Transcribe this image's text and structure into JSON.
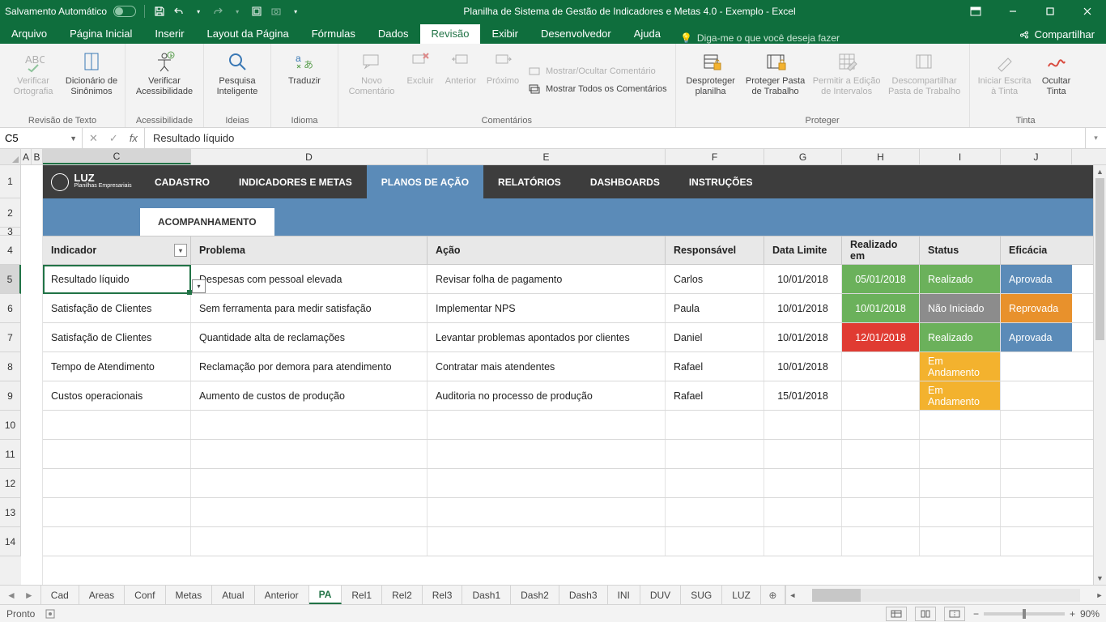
{
  "titlebar": {
    "autosave_label": "Salvamento Automático",
    "title": "Planilha de Sistema de Gestão de Indicadores e Metas 4.0 - Exemplo  -  Excel"
  },
  "menutabs": {
    "file": "Arquivo",
    "home": "Página Inicial",
    "insert": "Inserir",
    "layout": "Layout da Página",
    "formulas": "Fórmulas",
    "data": "Dados",
    "review": "Revisão",
    "view": "Exibir",
    "dev": "Desenvolvedor",
    "help": "Ajuda",
    "tellme": "Diga-me o que você deseja fazer",
    "share": "Compartilhar"
  },
  "ribbon": {
    "g1_label": "Revisão de Texto",
    "spellcheck": "Verificar Ortografia",
    "thesaurus": "Dicionário de Sinônimos",
    "g2_label": "Acessibilidade",
    "access": "Verificar Acessibilidade",
    "g3_label": "Ideias",
    "smart": "Pesquisa Inteligente",
    "g4_label": "Idioma",
    "translate": "Traduzir",
    "g5_label": "Comentários",
    "newc": "Novo Comentário",
    "del": "Excluir",
    "prev": "Anterior",
    "next": "Próximo",
    "show": "Mostrar/Ocultar Comentário",
    "showall": "Mostrar Todos os Comentários",
    "g6_label": "Proteger",
    "unprotect": "Desproteger planilha",
    "protectwb": "Proteger Pasta de Trabalho",
    "allowedit": "Permitir a Edição de Intervalos",
    "unshare": "Descompartilhar Pasta de Trabalho",
    "g7_label": "Tinta",
    "inkstart": "Iniciar Escrita à Tinta",
    "inkhide": "Ocultar Tinta"
  },
  "fbar": {
    "name": "C5",
    "formula": "Resultado líquido"
  },
  "cols": {
    "A": "A",
    "B": "B",
    "C": "C",
    "D": "D",
    "E": "E",
    "F": "F",
    "G": "G",
    "H": "H",
    "I": "I",
    "J": "J"
  },
  "luz": {
    "brand": "LUZ",
    "sub": "Planilhas Empresariais"
  },
  "nav": {
    "cadastro": "CADASTRO",
    "indicadores": "INDICADORES E METAS",
    "planos": "PLANOS DE AÇÃO",
    "relatorios": "RELATÓRIOS",
    "dashboards": "DASHBOARDS",
    "instrucoes": "INSTRUÇÕES"
  },
  "subtab": "ACOMPANHAMENTO",
  "thead": {
    "indicador": "Indicador",
    "problema": "Problema",
    "acao": "Ação",
    "resp": "Responsável",
    "limite": "Data Limite",
    "realizado": "Realizado em",
    "status": "Status",
    "eficacia": "Eficácia"
  },
  "rows": [
    {
      "ind": "Resultado líquido",
      "prob": "Despesas com pessoal elevada",
      "acao": "Revisar folha de pagamento",
      "resp": "Carlos",
      "lim": "10/01/2018",
      "real": "05/01/2018",
      "realbg": "#6bb15b",
      "status": "Realizado",
      "statusbg": "#6bb15b",
      "ef": "Aprovada",
      "efbg": "#5b8bb8"
    },
    {
      "ind": "Satisfação de Clientes",
      "prob": "Sem ferramenta para medir satisfação",
      "acao": "Implementar NPS",
      "resp": "Paula",
      "lim": "10/01/2018",
      "real": "10/01/2018",
      "realbg": "#6bb15b",
      "status": "Não Iniciado",
      "statusbg": "#8c8c8c",
      "ef": "Reprovada",
      "efbg": "#e8912c"
    },
    {
      "ind": "Satisfação de Clientes",
      "prob": "Quantidade alta de reclamações",
      "acao": "Levantar problemas apontados por clientes",
      "resp": "Daniel",
      "lim": "10/01/2018",
      "real": "12/01/2018",
      "realbg": "#e03b32",
      "status": "Realizado",
      "statusbg": "#6bb15b",
      "ef": "Aprovada",
      "efbg": "#5b8bb8"
    },
    {
      "ind": "Tempo de Atendimento",
      "prob": "Reclamação por demora para atendimento",
      "acao": "Contratar mais atendentes",
      "resp": "Rafael",
      "lim": "10/01/2018",
      "real": "",
      "realbg": "",
      "status": "Em Andamento",
      "statusbg": "#f3b22e",
      "ef": "",
      "efbg": ""
    },
    {
      "ind": "Custos operacionais",
      "prob": "Aumento de custos de produção",
      "acao": "Auditoria no processo de produção",
      "resp": "Rafael",
      "lim": "15/01/2018",
      "real": "",
      "realbg": "",
      "status": "Em Andamento",
      "statusbg": "#f3b22e",
      "ef": "",
      "efbg": ""
    }
  ],
  "sheets": [
    "Cad",
    "Areas",
    "Conf",
    "Metas",
    "Atual",
    "Anterior",
    "PA",
    "Rel1",
    "Rel2",
    "Rel3",
    "Dash1",
    "Dash2",
    "Dash3",
    "INI",
    "DUV",
    "SUG",
    "LUZ"
  ],
  "active_sheet": "PA",
  "status": {
    "ready": "Pronto",
    "zoom": "90%"
  }
}
